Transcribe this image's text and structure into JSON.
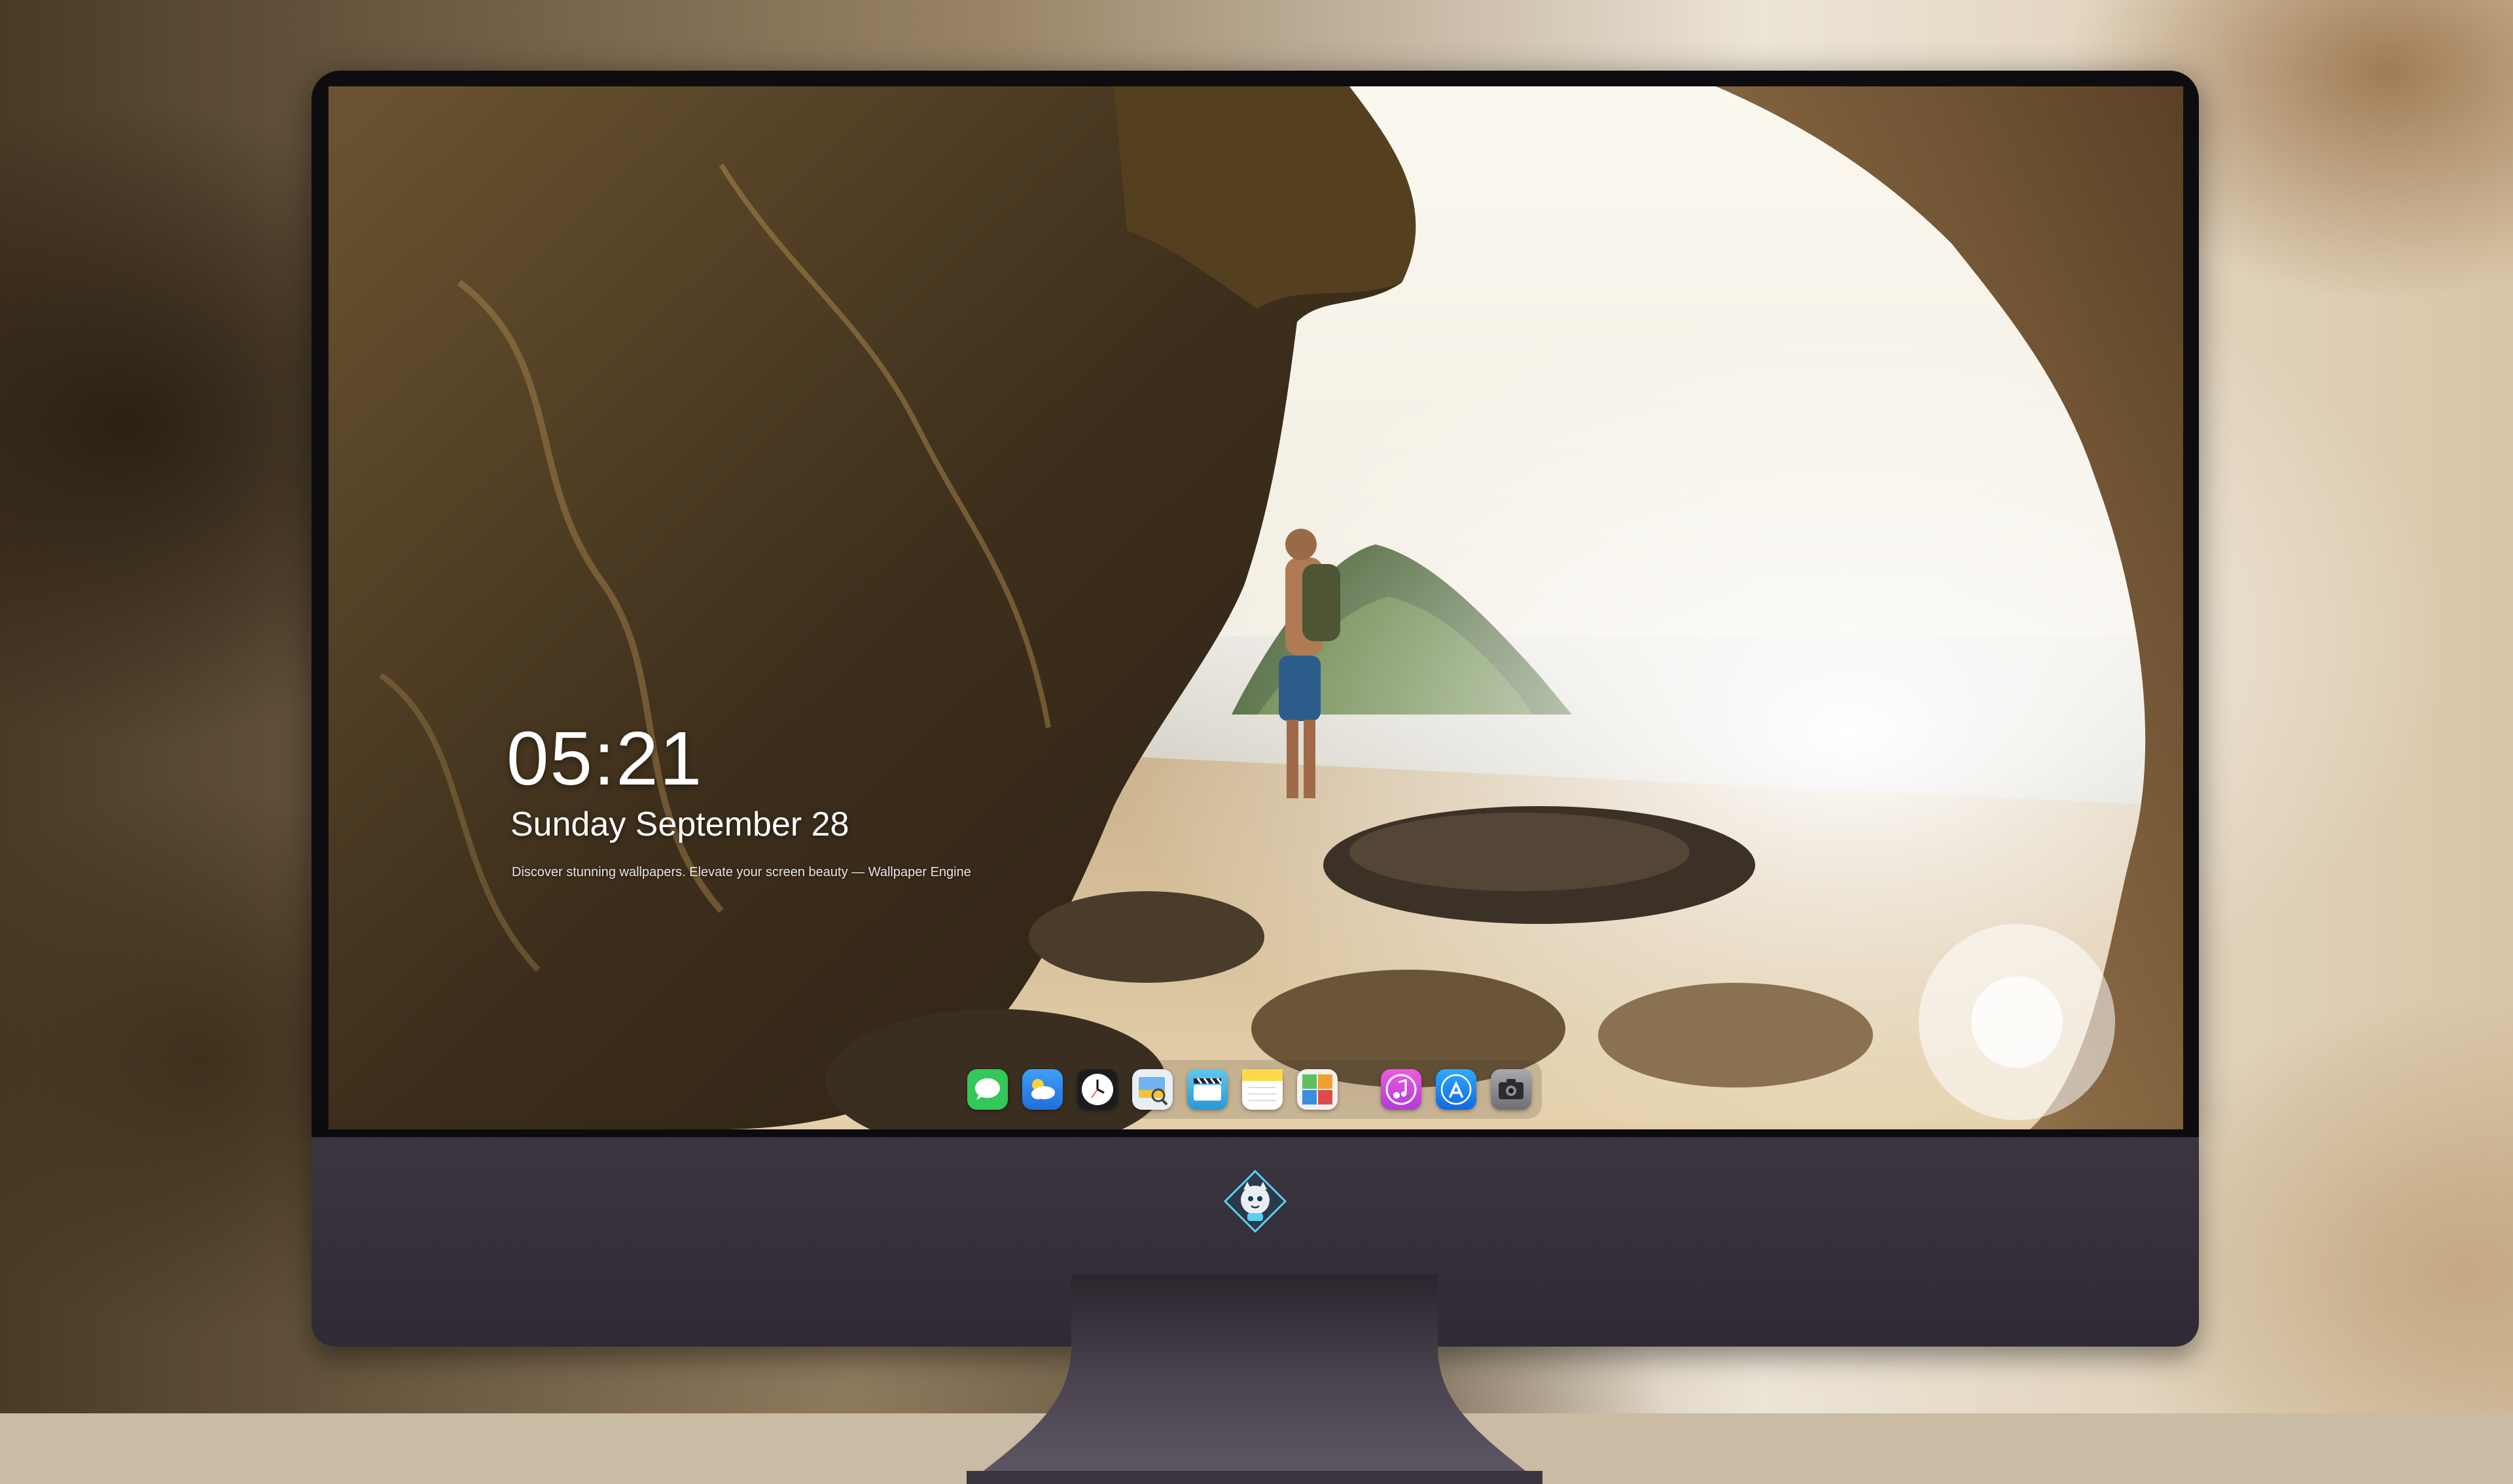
{
  "lock_screen": {
    "time": "05:21",
    "date": "Sunday September  28",
    "tagline": "Discover stunning wallpapers. Elevate your screen beauty — Wallpaper Engine"
  },
  "dock": {
    "items": [
      {
        "name": "messages",
        "icon": "messages-icon",
        "color": "#34c759"
      },
      {
        "name": "weather",
        "icon": "weather-icon",
        "color": "#1e88f5"
      },
      {
        "name": "clock",
        "icon": "clock-icon",
        "color": "#ffffff"
      },
      {
        "name": "preview",
        "icon": "preview-icon",
        "color": "#f5c53b"
      },
      {
        "name": "clips",
        "icon": "clips-icon",
        "color": "#3fb4e8"
      },
      {
        "name": "notes",
        "icon": "notes-icon",
        "color": "#ffd84a"
      },
      {
        "name": "photo-booth",
        "icon": "photo-booth-icon",
        "color": "#5fbf5f"
      },
      {
        "name": "music",
        "icon": "music-icon",
        "color": "#e34ad8"
      },
      {
        "name": "app-store",
        "icon": "app-store-icon",
        "color": "#1a8cf7"
      },
      {
        "name": "camera",
        "icon": "camera-icon",
        "color": "#8e8e93"
      }
    ]
  },
  "colors": {
    "bezel": "#0d0d10",
    "chin": "#36303b",
    "sky": "#fbf8f0",
    "rock": "#4a3a22",
    "sand": "#d9c29a"
  }
}
